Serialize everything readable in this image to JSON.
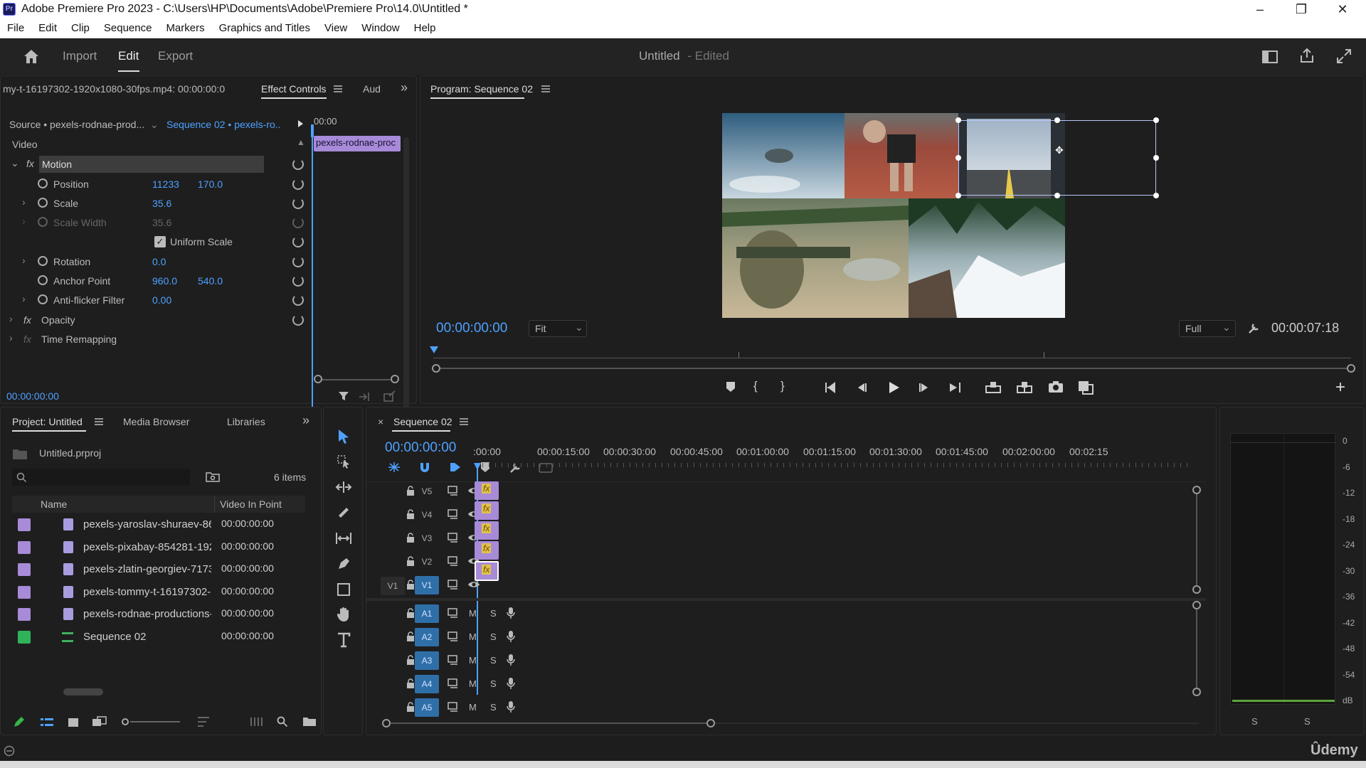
{
  "window": {
    "title": "Adobe Premiere Pro 2023 - C:\\Users\\HP\\Documents\\Adobe\\Premiere Pro\\14.0\\Untitled *",
    "app_icon": "Pr",
    "controls": {
      "minimize": "–",
      "restore": "❐",
      "close": "✕"
    }
  },
  "menu": [
    "File",
    "Edit",
    "Clip",
    "Sequence",
    "Markers",
    "Graphics and Titles",
    "View",
    "Window",
    "Help"
  ],
  "header": {
    "tabs": [
      "Import",
      "Edit",
      "Export"
    ],
    "active_tab": "Edit",
    "project_title": "Untitled",
    "project_status": "- Edited"
  },
  "effect_controls": {
    "clip_path": "my-t-16197302-1920x1080-30fps.mp4: 00:00:00:0",
    "tab_label": "Effect Controls",
    "tab_audio": "Aud",
    "source_label": "Source • pexels-rodnae-prod...",
    "sequence_label": "Sequence 02 • pexels-ro...",
    "ruler_time": "00:00",
    "clip_name": "pexels-rodnae-proc",
    "section_video": "Video",
    "motion_label": "Motion",
    "params": [
      {
        "name": "Position",
        "v1": "11233",
        "v2": "170.0"
      },
      {
        "name": "Scale",
        "v1": "35.6",
        "v2": ""
      },
      {
        "name": "Scale Width",
        "v1": "35.6",
        "v2": ""
      },
      {
        "name": "Uniform Scale",
        "v1": "",
        "v2": ""
      },
      {
        "name": "Rotation",
        "v1": "0.0",
        "v2": ""
      },
      {
        "name": "Anchor Point",
        "v1": "960.0",
        "v2": "540.0"
      },
      {
        "name": "Anti-flicker Filter",
        "v1": "0.00",
        "v2": ""
      }
    ],
    "opacity_label": "Opacity",
    "time_remap_label": "Time Remapping",
    "timecode": "00:00:00:00"
  },
  "program_monitor": {
    "title": "Program: Sequence 02",
    "timecode": "00:00:00:00",
    "fit": "Fit",
    "quality": "Full",
    "duration": "00:00:07:18"
  },
  "project": {
    "tab_label": "Project: Untitled",
    "tab_media": "Media Browser",
    "tab_libraries": "Libraries",
    "file_name": "Untitled.prproj",
    "item_count": "6 items",
    "col_name": "Name",
    "col_inpoint": "Video In Point",
    "items": [
      {
        "name": "pexels-yaroslav-shuraev-86",
        "in": "00:00:00:00",
        "color": "#a78ad8",
        "type": "clip"
      },
      {
        "name": "pexels-pixabay-854281-192",
        "in": "00:00:00:00",
        "color": "#a78ad8",
        "type": "clip"
      },
      {
        "name": "pexels-zlatin-georgiev-7173",
        "in": "00:00:00:00",
        "color": "#a78ad8",
        "type": "clip"
      },
      {
        "name": "pexels-tommy-t-16197302-",
        "in": "00:00:00:00",
        "color": "#a78ad8",
        "type": "clip"
      },
      {
        "name": "pexels-rodnae-productions-",
        "in": "00:00:00:00",
        "color": "#a78ad8",
        "type": "clip"
      },
      {
        "name": "Sequence 02",
        "in": "00:00:00:00",
        "color": "#2fb35a",
        "type": "sequence"
      }
    ]
  },
  "timeline": {
    "tab_label": "Sequence 02",
    "timecode": "00:00:00:00",
    "ruler": [
      ":00:00",
      "00:00:15:00",
      "00:00:30:00",
      "00:00:45:00",
      "00:01:00:00",
      "00:01:15:00",
      "00:01:30:00",
      "00:01:45:00",
      "00:02:00:00",
      "00:02:15"
    ],
    "video_tracks": [
      "V5",
      "V4",
      "V3",
      "V2",
      "V1"
    ],
    "audio_tracks": [
      "A1",
      "A2",
      "A3",
      "A4",
      "A5"
    ],
    "src_v1": "V1",
    "mute": "M",
    "solo": "S",
    "fx": "fx"
  },
  "meter": {
    "scale": [
      "0",
      "-6",
      "-12",
      "-18",
      "-24",
      "-30",
      "-36",
      "-42",
      "-48",
      "-54",
      "dB"
    ],
    "solo_left": "S",
    "solo_right": "S"
  },
  "watermark": "Ûdemy",
  "colors": {
    "accent": "#4ea1ff",
    "clip": "#a78ad8",
    "track_on": "#2f6fa8",
    "sequence": "#2fb35a"
  }
}
